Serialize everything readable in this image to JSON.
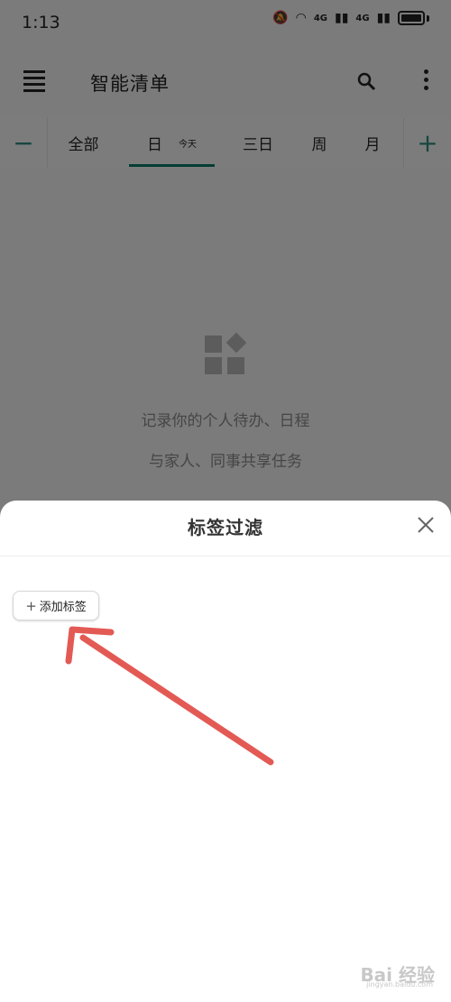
{
  "status": {
    "time": "1:13",
    "signal1": "4G",
    "signal2": "4G"
  },
  "app": {
    "title": "智能清单"
  },
  "tabs": {
    "items": [
      {
        "label": "全部"
      },
      {
        "label": "日",
        "subtitle": "今天"
      },
      {
        "label": "三日"
      },
      {
        "label": "周"
      },
      {
        "label": "月"
      }
    ],
    "active_index": 1
  },
  "empty": {
    "line1": "记录你的个人待办、日程",
    "line2": "与家人、同事共享任务"
  },
  "sheet": {
    "title": "标签过滤",
    "add_tag": "添加标签"
  },
  "watermark": {
    "main": "Bai 经验",
    "sub": "jingyan.baidu.com"
  },
  "colors": {
    "accent": "#0b7a68",
    "arrow": "#e35a55",
    "overlay": "rgba(0,0,0,0.50)"
  }
}
